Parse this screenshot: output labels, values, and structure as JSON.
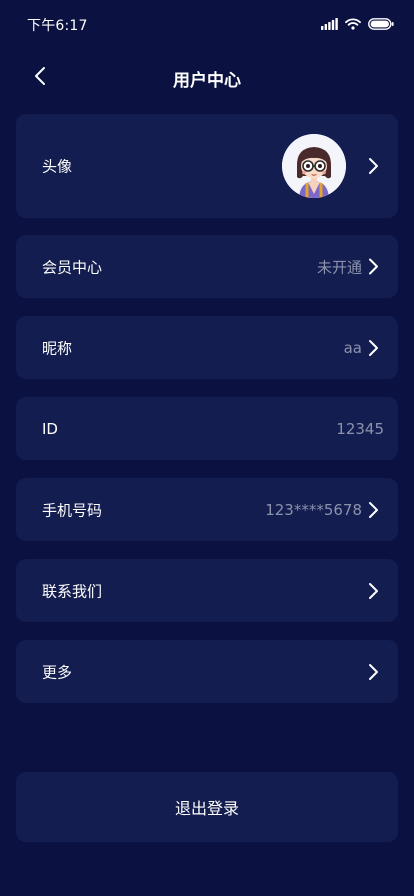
{
  "status_bar": {
    "time": "下午6:17",
    "icons": [
      "signal-icon",
      "wifi-icon",
      "battery-icon"
    ]
  },
  "header": {
    "title": "用户中心",
    "back_icon": "chevron-left-icon"
  },
  "rows": [
    {
      "label": "头像",
      "value": "",
      "has_avatar": true,
      "has_chevron": true
    },
    {
      "label": "会员中心",
      "value": "未开通",
      "has_chevron": true
    },
    {
      "label": "昵称",
      "value": "aa",
      "has_chevron": true
    },
    {
      "label": "ID",
      "value": "12345",
      "has_chevron": false
    },
    {
      "label": "手机号码",
      "value": "123****5678",
      "has_chevron": true
    },
    {
      "label": "联系我们",
      "value": "",
      "has_chevron": true
    },
    {
      "label": "更多",
      "value": "",
      "has_chevron": true
    }
  ],
  "logout": {
    "label": "退出登录"
  },
  "colors": {
    "background": "#0b1140",
    "card": "#141d4f",
    "text": "#ffffff",
    "muted_text": "#8c92ad"
  }
}
